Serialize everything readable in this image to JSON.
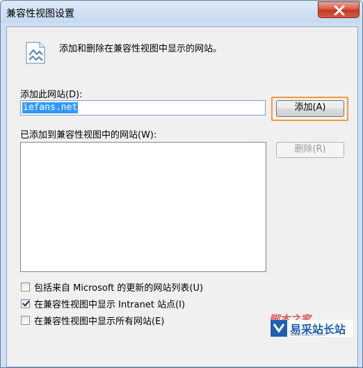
{
  "window": {
    "title": "兼容性视图设置"
  },
  "info": {
    "text": "添加和删除在兼容性视图中显示的网站。"
  },
  "add_site": {
    "label": "添加此网站(D):",
    "value": "iefans.net",
    "button": "添加(A)"
  },
  "list": {
    "label": "已添加到兼容性视图中的网站(W):",
    "items": [],
    "remove_button": "删除(R)"
  },
  "options": [
    {
      "label": "包括来自 Microsoft 的更新的网站列表(U)",
      "checked": false
    },
    {
      "label": "在兼容性视图中显示 Intranet 站点(I)",
      "checked": true
    },
    {
      "label": "在兼容性视图中显示所有网站(E)",
      "checked": false
    }
  ],
  "watermark": {
    "top": "脚本之家",
    "brand": "易采站长站",
    "sub": "Www.Easck.Com"
  },
  "colors": {
    "accent_focus": "#f49a34",
    "selection": "#3399ff"
  }
}
